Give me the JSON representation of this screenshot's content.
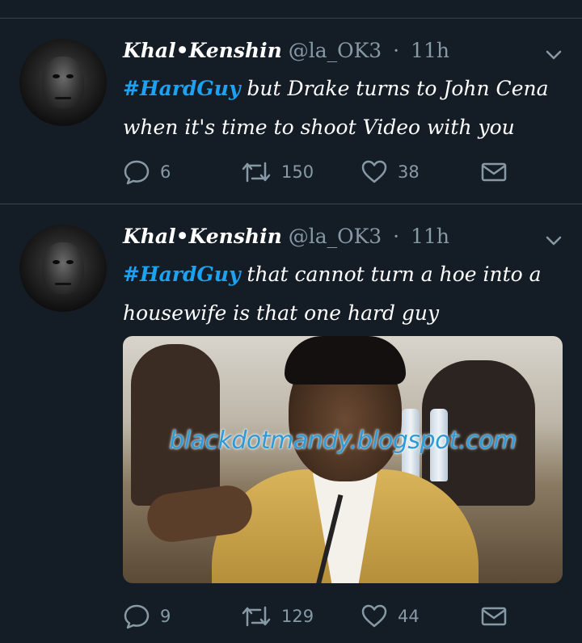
{
  "colors": {
    "background": "#141d26",
    "hashtag": "#1da1f2",
    "muted": "#8899a6",
    "divider": "#38444d"
  },
  "tweets": [
    {
      "display_name": "Khal•Kenshin",
      "handle": "@la_OK3",
      "separator": "·",
      "time": "11h",
      "hashtag": "#HardGuy",
      "text_line1": " but Drake turns to John Cena",
      "text_line2": "when it's time to shoot Video with you",
      "reply_count": "6",
      "retweet_count": "150",
      "like_count": "38",
      "icons": [
        "reply-icon",
        "retweet-icon",
        "like-icon",
        "dm-icon",
        "chevron-down-icon"
      ]
    },
    {
      "display_name": "Khal•Kenshin",
      "handle": "@la_OK3",
      "separator": "·",
      "time": "11h",
      "hashtag": "#HardGuy",
      "text_line1": " that cannot turn a hoe into a",
      "text_line2": "housewife is that one hard guy",
      "media_watermark": "blackdotmandy.blogspot.com",
      "reply_count": "9",
      "retweet_count": "129",
      "like_count": "44",
      "icons": [
        "reply-icon",
        "retweet-icon",
        "like-icon",
        "dm-icon",
        "chevron-down-icon"
      ]
    }
  ]
}
